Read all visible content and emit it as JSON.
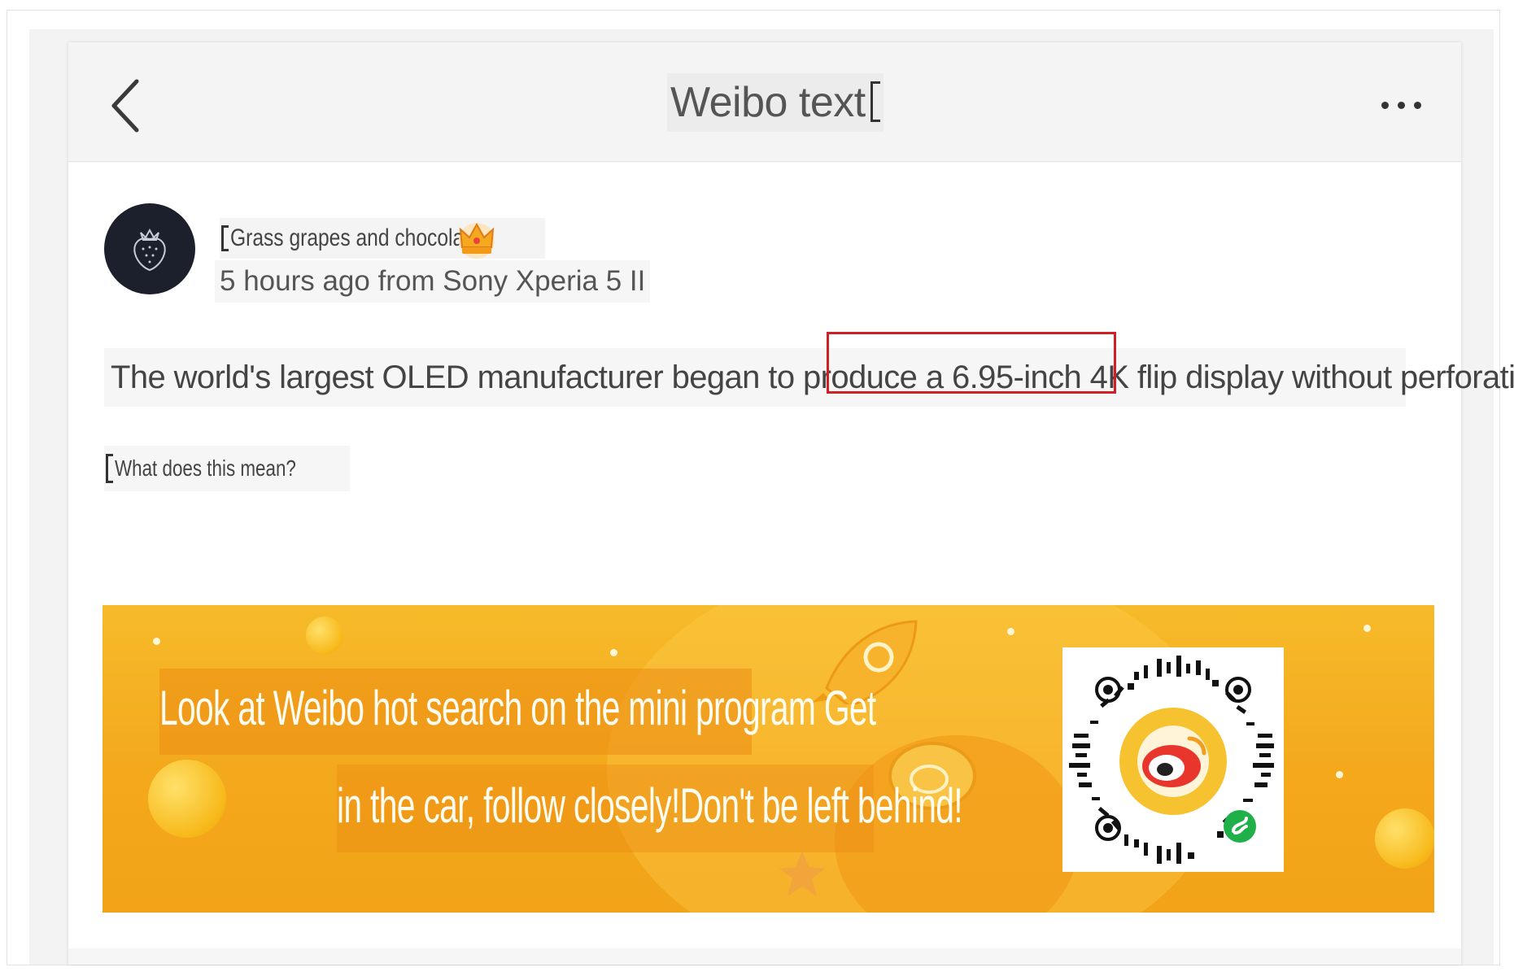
{
  "header": {
    "title": "Weibo text"
  },
  "post": {
    "author": "Grass grapes and chocolate",
    "meta": "5 hours ago from Sony Xperia 5 II",
    "text_before": "The world's largest OLED manufacturer began to produce a ",
    "text_highlight": "6.95-inch 4K flip display",
    "text_after": " without perforation.",
    "question": "What does this mean?"
  },
  "banner": {
    "line1": "Look at Weibo hot search on the mini program Get",
    "line2": "in the car, follow closely!Don't be left behind!"
  },
  "icons": {
    "back": "chevron-left-icon",
    "more": "more-horizontal-icon",
    "crown": "crown-badge-icon",
    "qr": "qr-code-icon",
    "weibo_logo": "weibo-logo-icon",
    "mini_program": "mini-program-icon"
  },
  "colors": {
    "highlight_border": "#d11f27",
    "banner": "#f4a81c",
    "avatar_bg": "#1c202c"
  }
}
